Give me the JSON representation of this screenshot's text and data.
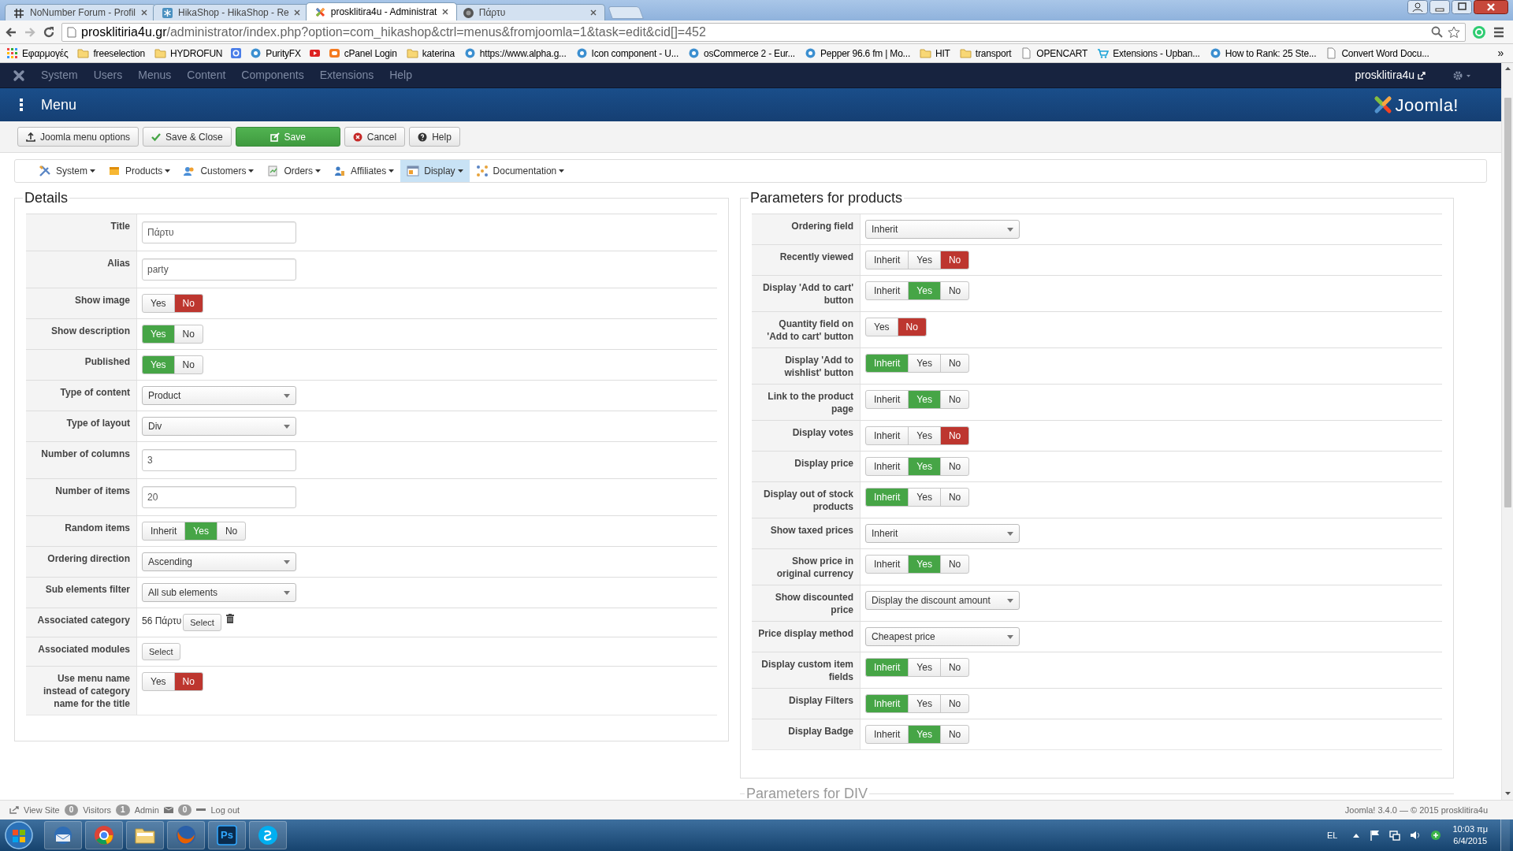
{
  "browser": {
    "tabs": [
      {
        "title": "NoNumber Forum - Profil",
        "selected": false
      },
      {
        "title": "HikaShop - HikaShop - Re",
        "selected": false
      },
      {
        "title": "prosklitira4u - Administrat",
        "selected": true
      },
      {
        "title": "Πάρτυ",
        "selected": false
      }
    ],
    "url": {
      "host": "prosklitiria4u.gr",
      "path": "/administrator/index.php?option=com_hikashop&ctrl=menus&fromjoomla=1&task=edit&cid[]=452"
    },
    "bookmarks": [
      {
        "kind": "apps",
        "label": "Εφαρμογές"
      },
      {
        "kind": "folder",
        "label": "freeselection"
      },
      {
        "kind": "folder",
        "label": "HYDROFUN"
      },
      {
        "kind": "google"
      },
      {
        "kind": "site",
        "label": "PurityFX"
      },
      {
        "kind": "video"
      },
      {
        "kind": "cpanel",
        "label": "cPanel Login"
      },
      {
        "kind": "folder",
        "label": "katerina"
      },
      {
        "kind": "site",
        "label": "https://www.alpha.g..."
      },
      {
        "kind": "site",
        "label": "Icon component - U..."
      },
      {
        "kind": "site",
        "label": "osCommerce 2 - Eur..."
      },
      {
        "kind": "site",
        "label": "Pepper 96.6 fm | Mo..."
      },
      {
        "kind": "folder",
        "label": "HIT"
      },
      {
        "kind": "folder",
        "label": "transport"
      },
      {
        "kind": "page",
        "label": "OPENCART"
      },
      {
        "kind": "cart",
        "label": "Extensions - Upban..."
      },
      {
        "kind": "site",
        "label": "How to Rank: 25 Ste..."
      },
      {
        "kind": "page",
        "label": "Convert Word Docu..."
      }
    ],
    "more": "»"
  },
  "admin_menu": {
    "items": [
      "System",
      "Users",
      "Menus",
      "Content",
      "Components",
      "Extensions",
      "Help"
    ],
    "user": "prosklitira4u"
  },
  "header": {
    "title": "Menu",
    "logo": "Joomla!"
  },
  "toolbar": [
    {
      "kind": "default",
      "label": "Joomla menu options"
    },
    {
      "kind": "default",
      "label": "Save & Close"
    },
    {
      "kind": "primary",
      "label": "Save"
    },
    {
      "kind": "default",
      "label": "Cancel"
    },
    {
      "kind": "default",
      "label": "Help"
    }
  ],
  "submenu": [
    {
      "label": "System",
      "selected": false
    },
    {
      "label": "Products",
      "selected": false
    },
    {
      "label": "Customers",
      "selected": false
    },
    {
      "label": "Orders",
      "selected": false
    },
    {
      "label": "Affiliates",
      "selected": false
    },
    {
      "label": "Display",
      "selected": true
    },
    {
      "label": "Documentation",
      "selected": false
    }
  ],
  "details": {
    "legend": "Details",
    "fields": [
      {
        "label": "Title",
        "kind": "text",
        "value": "Πάρτυ"
      },
      {
        "label": "Alias",
        "kind": "text",
        "value": "party"
      },
      {
        "label": "Show image",
        "kind": "toggle",
        "options": [
          {
            "label": "Yes",
            "kind": "yes",
            "selected": false
          },
          {
            "label": "No",
            "kind": "no",
            "selected": true
          }
        ]
      },
      {
        "label": "Show description",
        "kind": "toggle",
        "options": [
          {
            "label": "Yes",
            "kind": "yes",
            "selected": true
          },
          {
            "label": "No",
            "kind": "no",
            "selected": false
          }
        ]
      },
      {
        "label": "Published",
        "kind": "toggle",
        "options": [
          {
            "label": "Yes",
            "kind": "yes",
            "selected": true
          },
          {
            "label": "No",
            "kind": "no",
            "selected": false
          }
        ]
      },
      {
        "label": "Type of content",
        "kind": "select",
        "value": "Product"
      },
      {
        "label": "Type of layout",
        "kind": "select",
        "value": "Div"
      },
      {
        "label": "Number of columns",
        "kind": "text",
        "value": "3"
      },
      {
        "label": "Number of items",
        "kind": "text",
        "value": "20"
      },
      {
        "label": "Random items",
        "kind": "toggle",
        "options": [
          {
            "label": "Inherit",
            "kind": "inherit",
            "selected": false
          },
          {
            "label": "Yes",
            "kind": "yes",
            "selected": true
          },
          {
            "label": "No",
            "kind": "no",
            "selected": false
          }
        ]
      },
      {
        "label": "Ordering direction",
        "kind": "select",
        "value": "Ascending"
      },
      {
        "label": "Sub elements filter",
        "kind": "select",
        "value": "All sub elements"
      },
      {
        "label": "Associated category",
        "kind": "category",
        "value": "56 Πάρτυ",
        "button": "Select"
      },
      {
        "label": "Associated modules",
        "kind": "button",
        "button": "Select"
      },
      {
        "label": "Use menu name instead of category name for the title",
        "kind": "toggle",
        "options": [
          {
            "label": "Yes",
            "kind": "yes",
            "selected": false
          },
          {
            "label": "No",
            "kind": "no",
            "selected": true
          }
        ]
      }
    ]
  },
  "products": {
    "legend": "Parameters for products",
    "fields": [
      {
        "label": "Ordering field",
        "kind": "select",
        "value": "Inherit"
      },
      {
        "label": "Recently viewed",
        "kind": "toggle",
        "options": [
          {
            "label": "Inherit",
            "kind": "inherit",
            "selected": false
          },
          {
            "label": "Yes",
            "kind": "yes",
            "selected": false
          },
          {
            "label": "No",
            "kind": "no",
            "selected": true
          }
        ]
      },
      {
        "label": "Display 'Add to cart' button",
        "kind": "toggle",
        "options": [
          {
            "label": "Inherit",
            "kind": "inherit",
            "selected": false
          },
          {
            "label": "Yes",
            "kind": "yes",
            "selected": true
          },
          {
            "label": "No",
            "kind": "no",
            "selected": false
          }
        ]
      },
      {
        "label": "Quantity field on 'Add to cart' button",
        "kind": "toggle",
        "options": [
          {
            "label": "Yes",
            "kind": "yes",
            "selected": false
          },
          {
            "label": "No",
            "kind": "no",
            "selected": true
          }
        ]
      },
      {
        "label": "Display 'Add to wishlist' button",
        "kind": "toggle",
        "options": [
          {
            "label": "Inherit",
            "kind": "inherit",
            "selected": true
          },
          {
            "label": "Yes",
            "kind": "yes",
            "selected": false
          },
          {
            "label": "No",
            "kind": "no",
            "selected": false
          }
        ]
      },
      {
        "label": "Link to the product page",
        "kind": "toggle",
        "options": [
          {
            "label": "Inherit",
            "kind": "inherit",
            "selected": false
          },
          {
            "label": "Yes",
            "kind": "yes",
            "selected": true
          },
          {
            "label": "No",
            "kind": "no",
            "selected": false
          }
        ]
      },
      {
        "label": "Display votes",
        "kind": "toggle",
        "options": [
          {
            "label": "Inherit",
            "kind": "inherit",
            "selected": false
          },
          {
            "label": "Yes",
            "kind": "yes",
            "selected": false
          },
          {
            "label": "No",
            "kind": "no",
            "selected": true
          }
        ]
      },
      {
        "label": "Display price",
        "kind": "toggle",
        "options": [
          {
            "label": "Inherit",
            "kind": "inherit",
            "selected": false
          },
          {
            "label": "Yes",
            "kind": "yes",
            "selected": true
          },
          {
            "label": "No",
            "kind": "no",
            "selected": false
          }
        ]
      },
      {
        "label": "Display out of stock products",
        "kind": "toggle",
        "options": [
          {
            "label": "Inherit",
            "kind": "inherit",
            "selected": true
          },
          {
            "label": "Yes",
            "kind": "yes",
            "selected": false
          },
          {
            "label": "No",
            "kind": "no",
            "selected": false
          }
        ]
      },
      {
        "label": "Show taxed prices",
        "kind": "select",
        "value": "Inherit"
      },
      {
        "label": "Show price in original currency",
        "kind": "toggle",
        "options": [
          {
            "label": "Inherit",
            "kind": "inherit",
            "selected": false
          },
          {
            "label": "Yes",
            "kind": "yes",
            "selected": true
          },
          {
            "label": "No",
            "kind": "no",
            "selected": false
          }
        ]
      },
      {
        "label": "Show discounted price",
        "kind": "select",
        "value": "Display the discount amount"
      },
      {
        "label": "Price display method",
        "kind": "select",
        "value": "Cheapest price"
      },
      {
        "label": "Display custom item fields",
        "kind": "toggle",
        "options": [
          {
            "label": "Inherit",
            "kind": "inherit",
            "selected": true
          },
          {
            "label": "Yes",
            "kind": "yes",
            "selected": false
          },
          {
            "label": "No",
            "kind": "no",
            "selected": false
          }
        ]
      },
      {
        "label": "Display Filters",
        "kind": "toggle",
        "options": [
          {
            "label": "Inherit",
            "kind": "inherit",
            "selected": true
          },
          {
            "label": "Yes",
            "kind": "yes",
            "selected": false
          },
          {
            "label": "No",
            "kind": "no",
            "selected": false
          }
        ]
      },
      {
        "label": "Display Badge",
        "kind": "toggle",
        "options": [
          {
            "label": "Inherit",
            "kind": "inherit",
            "selected": false
          },
          {
            "label": "Yes",
            "kind": "yes",
            "selected": true
          },
          {
            "label": "No",
            "kind": "no",
            "selected": false
          }
        ]
      }
    ]
  },
  "div_params": {
    "legend": "Parameters for DIV"
  },
  "status_bar": {
    "view_site": "View Site",
    "visitors_count": "0",
    "visitors": "Visitors",
    "admin_count": "1",
    "admin": "Admin",
    "messages_count": "0",
    "logout": "Log out",
    "version": "Joomla! 3.4.0 — © 2015 prosklitira4u"
  },
  "taskbar": {
    "apps": [
      {
        "kind": "mail"
      },
      {
        "kind": "chrome"
      },
      {
        "kind": "files"
      },
      {
        "kind": "firefox"
      },
      {
        "kind": "photoshop",
        "label": "Ps"
      },
      {
        "kind": "skype"
      }
    ],
    "language": "EL",
    "time": "10:03 πμ",
    "date": "6/4/2015"
  }
}
